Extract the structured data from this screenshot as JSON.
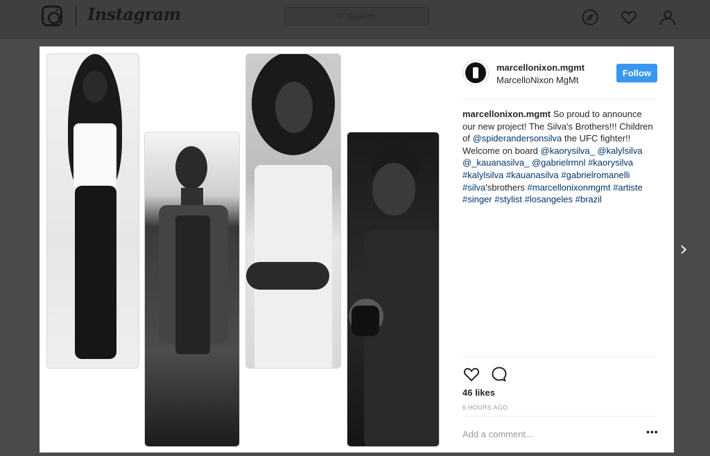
{
  "app": {
    "wordmark": "Instagram"
  },
  "topbar": {
    "search_placeholder": "Search",
    "icons": [
      "compass-icon",
      "heart-icon",
      "profile-icon"
    ]
  },
  "post": {
    "username": "marcellonixon.mgmt",
    "full_name": "MarcelloNixon MgMt",
    "follow_label": "Follow",
    "caption": {
      "line1_text": " So proud to announce our new project! The Silva's Brothers!!! Children of ",
      "mention1": "@spiderandersonsilva",
      "text2": " the UFC fighter!! Welcome on board ",
      "mention2": "@kaorysilva_",
      "mention3": "@kalylsilva",
      "mention4": "@_kauanasilva_",
      "mention5": "@gabrielrmnl",
      "tag1": "#kaorysilva",
      "tag2": "#kalylsilva",
      "tag3": "#kauanasilva",
      "tag4": "#gabrielromanelli",
      "tag5": "#silva",
      "text3": "'sbrothers",
      "tag6": "#marcellonixonmgmt",
      "tag7": "#artiste",
      "tag8": "#singer",
      "tag9": "#stylist",
      "tag10": "#losangeles",
      "tag11": "#brazil"
    },
    "likes": "46 likes",
    "time_ago": "6 HOURS AGO",
    "comment_placeholder": "Add a comment...",
    "more_label": "•••"
  },
  "nav": {
    "next_arrow": "›"
  }
}
